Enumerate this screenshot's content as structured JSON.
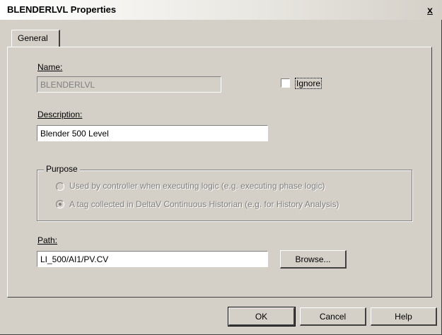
{
  "window": {
    "title": "BLENDERLVL Properties",
    "close_glyph": "x"
  },
  "tabs": [
    {
      "label": "General",
      "selected": true
    }
  ],
  "general": {
    "name_label": "Name:",
    "name_value": "BLENDERLVL",
    "ignore_label": "Ignore",
    "ignore_checked": false,
    "description_label": "Description:",
    "description_value": "Blender 500 Level",
    "purpose": {
      "legend": "Purpose",
      "options": [
        {
          "label": "Used by controller when executing logic (e.g. executing phase logic)",
          "selected": false,
          "enabled": false
        },
        {
          "label": "A tag collected in DeltaV Continuous Historian (e.g. for History Analysis)",
          "selected": true,
          "enabled": false
        }
      ]
    },
    "path_label": "Path:",
    "path_value": "LI_500/AI1/PV.CV",
    "browse_label": "Browse..."
  },
  "buttons": {
    "ok": "OK",
    "cancel": "Cancel",
    "help": "Help"
  },
  "colors": {
    "dialog_bg": "#d4d0c8",
    "disabled_text": "#808080"
  }
}
